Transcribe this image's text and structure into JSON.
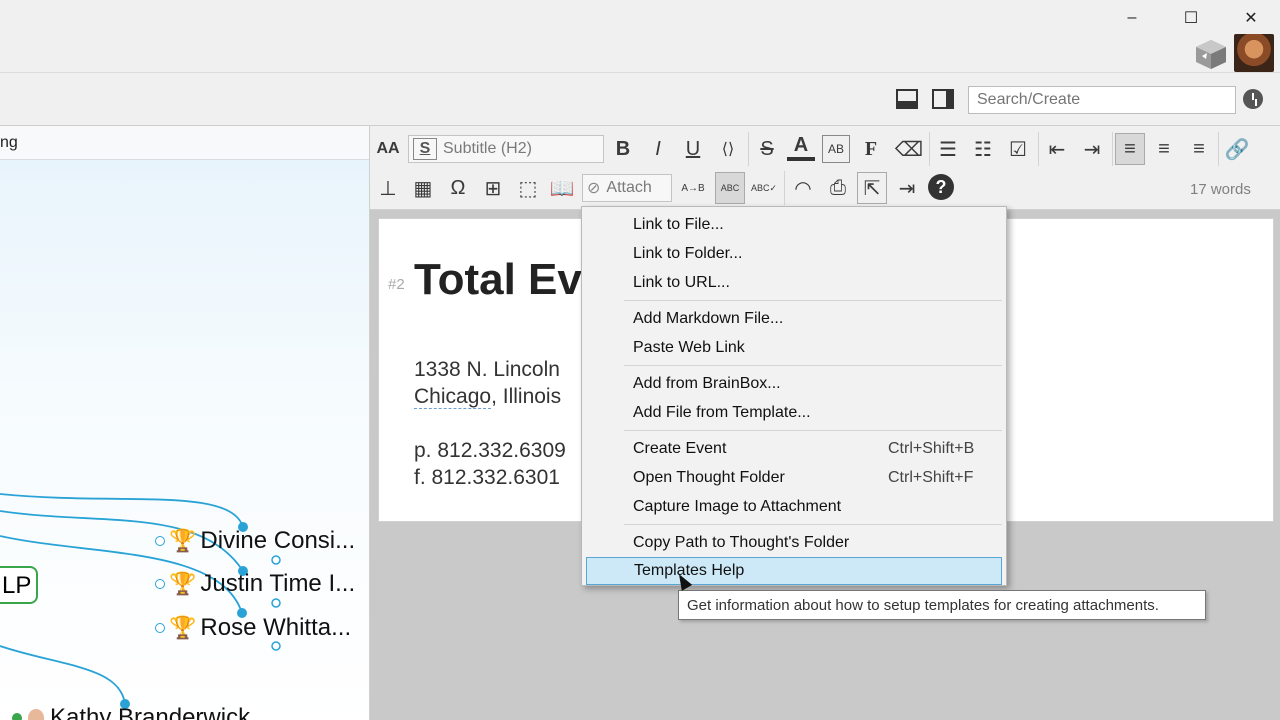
{
  "window": {
    "minimize": "–",
    "maximize": "☐",
    "close": "✕"
  },
  "topbar": {
    "search_placeholder": "Search/Create"
  },
  "map": {
    "tab_label": "ng",
    "nodes": [
      "Divine Consi...",
      "Justin Time I...",
      "Rose Whitta...",
      "Kathy Branderwick"
    ],
    "lp_label": "LP"
  },
  "toolbar": {
    "style_value": "Subtitle (H2)",
    "attach_label": "Attach",
    "word_count": "17 words",
    "font_size_icon": "AA",
    "bold": "B",
    "italic": "I",
    "underline": "U",
    "strike": "S",
    "font": "F",
    "help": "?",
    "omega": "Ω",
    "style_s": "S"
  },
  "document": {
    "heading_marker": "#2",
    "heading": "Total Eve",
    "address1": "1338 N. Lincoln",
    "address2_city": "Chicago",
    "address2_rest": ", Illinois",
    "phone": "p. 812.332.6309",
    "fax": "f. 812.332.6301"
  },
  "context_menu": {
    "items": [
      {
        "label": "Link to File...",
        "shortcut": ""
      },
      {
        "label": "Link to Folder...",
        "shortcut": ""
      },
      {
        "label": "Link to URL...",
        "shortcut": ""
      },
      {
        "label": "Add Markdown File...",
        "shortcut": ""
      },
      {
        "label": "Paste Web Link",
        "shortcut": ""
      },
      {
        "label": "Add from BrainBox...",
        "shortcut": ""
      },
      {
        "label": "Add File from Template...",
        "shortcut": ""
      },
      {
        "label": "Create Event",
        "shortcut": "Ctrl+Shift+B"
      },
      {
        "label": "Open Thought Folder",
        "shortcut": "Ctrl+Shift+F"
      },
      {
        "label": "Capture Image to Attachment",
        "shortcut": ""
      },
      {
        "label": "Copy Path to Thought's Folder",
        "shortcut": ""
      },
      {
        "label": "Templates Help",
        "shortcut": ""
      }
    ],
    "highlighted": "Templates Help"
  },
  "tooltip": "Get information about how to setup templates for creating attachments.",
  "colors": {
    "accent": "#29a3d6",
    "menu_highlight": "#cde8f7",
    "trophy": "#e6b417"
  }
}
